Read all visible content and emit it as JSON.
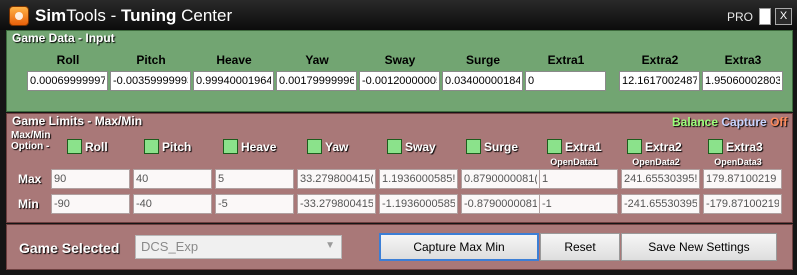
{
  "window": {
    "title_bold1": "Sim",
    "title_part2": "Tools - ",
    "title_bold2": "Tuning",
    "title_part3": " Center",
    "pro_label": "PRO",
    "close_label": "X"
  },
  "game_data": {
    "title": "Game Data - Input",
    "columns": [
      {
        "label": "Roll",
        "value": "0.000699999971"
      },
      {
        "label": "Pitch",
        "value": "-0.00359999993"
      },
      {
        "label": "Heave",
        "value": "0.999400019645"
      },
      {
        "label": "Yaw",
        "value": "0.00179999996"
      },
      {
        "label": "Sway",
        "value": "-0.00120000005"
      },
      {
        "label": "Surge",
        "value": "0.034000001847"
      },
      {
        "label": "Extra1",
        "value": "0"
      },
      {
        "label": "Extra2",
        "value": "12.1617002487"
      },
      {
        "label": "Extra3",
        "value": "1.95060002803"
      }
    ]
  },
  "game_limits": {
    "title": "Game Limits - Max/Min",
    "balance": "Balance",
    "capture": "Capture",
    "off": "Off",
    "option_line1": "Max/Min",
    "option_line2": "Option -",
    "max_label": "Max",
    "min_label": "Min",
    "columns": [
      {
        "label": "Roll",
        "sub": "",
        "max": "90",
        "min": "-90"
      },
      {
        "label": "Pitch",
        "sub": "",
        "max": "40",
        "min": "-40"
      },
      {
        "label": "Heave",
        "sub": "",
        "max": "5",
        "min": "-5"
      },
      {
        "label": "Yaw",
        "sub": "",
        "max": "33.279800415(",
        "min": "-33.279800415"
      },
      {
        "label": "Sway",
        "sub": "",
        "max": "1.1936000585!",
        "min": "-1.1936000585"
      },
      {
        "label": "Surge",
        "sub": "",
        "max": "0.8790000081(",
        "min": "-0.8790000081"
      },
      {
        "label": "Extra1",
        "sub": "OpenData1",
        "max": "1",
        "min": "-1"
      },
      {
        "label": "Extra2",
        "sub": "OpenData2",
        "max": "241.65530395!",
        "min": "-241.65530395"
      },
      {
        "label": "Extra3",
        "sub": "OpenData3",
        "max": "179.87100219",
        "min": "-179.87100219"
      }
    ]
  },
  "bottom": {
    "game_selected_label": "Game Selected",
    "game_selected_value": "DCS_Exp",
    "capture_button": "Capture Max Min",
    "reset_button": "Reset",
    "save_button": "Save New Settings"
  }
}
